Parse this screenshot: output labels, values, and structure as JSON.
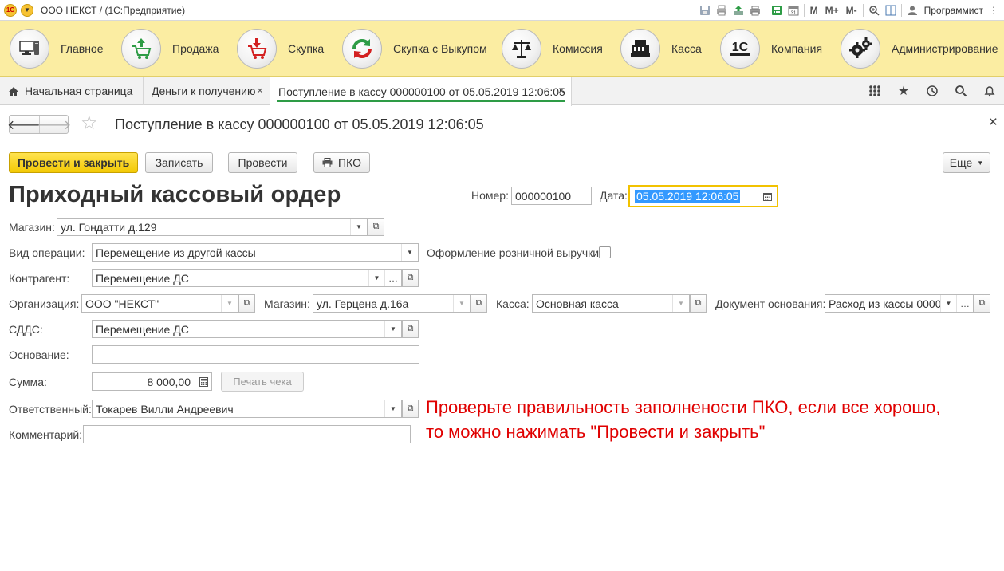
{
  "titlebar": {
    "title": "ООО НЕКСТ /   (1С:Предприятие)",
    "logo_text": "1С",
    "m": "M",
    "mplus": "M+",
    "mminus": "M-",
    "calendar_day": "31",
    "user": "Программист"
  },
  "sections": [
    {
      "label": "Главное",
      "icon": "computer-icon"
    },
    {
      "label": "Продажа",
      "icon": "cart-up-icon"
    },
    {
      "label": "Скупка",
      "icon": "cart-down-icon"
    },
    {
      "label": "Скупка с Выкупом",
      "icon": "refresh-icon"
    },
    {
      "label": "Комиссия",
      "icon": "scales-icon"
    },
    {
      "label": "Касса",
      "icon": "cash-register-icon"
    },
    {
      "label": "Компания",
      "icon": "1c-icon"
    },
    {
      "label": "Администрирование",
      "icon": "gears-icon"
    }
  ],
  "tabs": [
    {
      "label": "Начальная страница"
    },
    {
      "label": "Деньги к получению"
    },
    {
      "label": "Поступление в кассу 000000100 от 05.05.2019 12:06:05"
    }
  ],
  "form": {
    "title": "Поступление в кассу 000000100 от 05.05.2019 12:06:05",
    "buttons": {
      "post_close": "Провести и закрыть",
      "save": "Записать",
      "post": "Провести",
      "pko": "ПКО",
      "more": "Еще"
    },
    "doc_title": "Приходный кассовый ордер",
    "number_label": "Номер:",
    "number_value": "000000100",
    "date_label": "Дата:",
    "date_value": "05.05.2019 12:06:05",
    "store_label": "Магазин:",
    "store_value": "ул. Гондатти д.129",
    "operation_label": "Вид операции:",
    "operation_value": "Перемещение из другой кассы",
    "retail_label": "Оформление розничной выручки:",
    "counterparty_label": "Контрагент:",
    "counterparty_value": "Перемещение ДС",
    "org_label": "Организация:",
    "org_value": "ООО \"НЕКСТ\"",
    "store2_label": "Магазин:",
    "store2_value": "ул. Герцена д.16а",
    "cashbox_label": "Касса:",
    "cashbox_value": "Основная касса",
    "basis_doc_label": "Документ основания:",
    "basis_doc_value": "Расход из кассы 00000",
    "cfs_label": "СДДС:",
    "cfs_value": "Перемещение ДС",
    "reason_label": "Основание:",
    "reason_value": "",
    "sum_label": "Сумма:",
    "sum_value": "8 000,00",
    "print_receipt": "Печать чека",
    "responsible_label": "Ответственный:",
    "responsible_value": "Токарев Вилли Андреевич",
    "comment_label": "Комментарий:",
    "comment_value": ""
  },
  "hint": {
    "line1": "Проверьте правильность заполнености ПКО, если все хорошо,",
    "line2": "то можно нажимать \"Провести и закрыть\""
  },
  "colors": {
    "section_bg": "#fbeda2",
    "primary_button": "#f3c905",
    "active_tab_underline": "#2e9c46",
    "hint_text": "#e00000",
    "date_selection": "#3399ff"
  }
}
